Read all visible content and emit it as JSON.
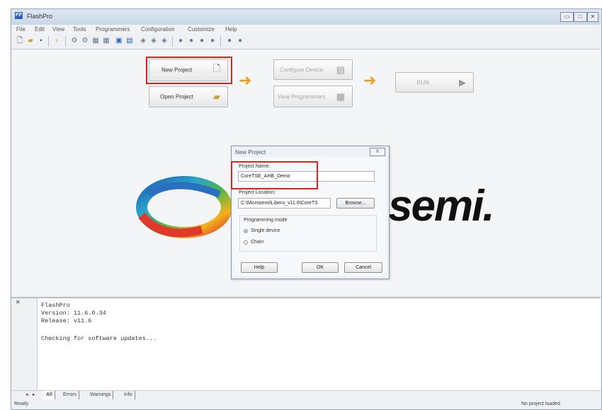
{
  "window": {
    "title": "FlashPro",
    "app_icon": "FP"
  },
  "menu": [
    "File",
    "Edit",
    "View",
    "Tools",
    "Programmers",
    "Configuration",
    "Customize",
    "Help"
  ],
  "flow": {
    "new_project": "New Project",
    "open_project": "Open Project",
    "configure_device": "Configure Device",
    "view_programmers": "View Programmers",
    "run": "RUN"
  },
  "logo": {
    "text": "semi."
  },
  "dialog": {
    "title": "New Project",
    "close": "X",
    "project_name_label": "Project Name:",
    "project_name_value": "CoreTSE_AHB_Demo",
    "project_location_label": "Project Location:",
    "project_location_value": "C:\\Microsemi\\Libero_v11.6\\CoreTS",
    "browse": "Browse...",
    "programming_mode_label": "Programming mode",
    "mode_options": [
      "Single device",
      "Chain"
    ],
    "mode_selected": "Single device",
    "help": "Help",
    "ok": "OK",
    "cancel": "Cancel"
  },
  "log": {
    "lines": [
      "FlashPro",
      "Version: 11.6.0.34",
      "Release: v11.6",
      "",
      "Checking for software updates..."
    ]
  },
  "tabs": [
    "All",
    "Errors",
    "Warnings",
    "Info"
  ],
  "status": {
    "left": "Ready",
    "right": "No project loaded"
  },
  "colors": {
    "highlight": "#e02020",
    "arrow": "#f0a020",
    "title_bar": "#c8d6e8"
  }
}
